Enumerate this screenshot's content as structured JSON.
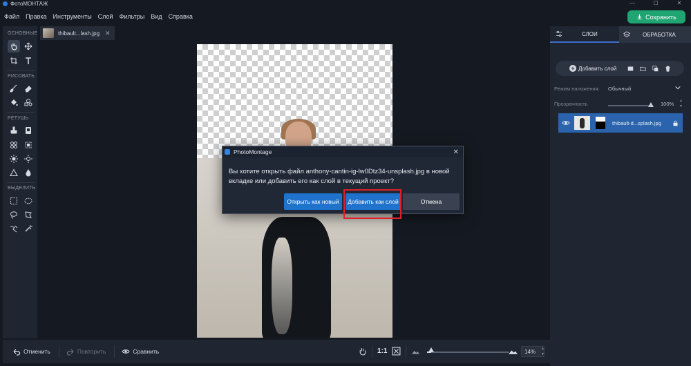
{
  "app": {
    "title": "ФотоМОНТАЖ"
  },
  "window_controls": [
    "—",
    "☐",
    "✕"
  ],
  "menu": [
    "Файл",
    "Правка",
    "Инструменты",
    "Слой",
    "Фильтры",
    "Вид",
    "Справка"
  ],
  "save_button": {
    "label": "Сохранить"
  },
  "toolbar": {
    "sections": [
      "ОСНОВНЫЕ",
      "РИСОВАТЬ",
      "РЕТУШЬ",
      "ВЫДЕЛИТЬ"
    ]
  },
  "document_tab": {
    "name": "thibault...lash.jpg"
  },
  "right_panel": {
    "tabs": [
      "СЛОИ",
      "ОБРАБОТКА"
    ],
    "add_layer_label": "Добавить слой",
    "blend_mode_label": "Режим наложения:",
    "blend_mode_value": "Обычный",
    "opacity_label": "Прозрачность",
    "opacity_value": "100%",
    "opacity_fraction": 1.0,
    "layers": [
      {
        "name": "thibault-d...splash.jpg"
      }
    ]
  },
  "bottom_bar": {
    "undo": "Отменить",
    "redo": "Повторить",
    "compare": "Сравнить",
    "actual_size": "1:1",
    "zoom_value": "14%",
    "zoom_fraction": 0.05
  },
  "dialog": {
    "title": "PhotoMontage",
    "message": "Вы хотите открыть файл anthony-cantin-ig-lw0Dtz34-unsplash.jpg в новой вкладке или добавить его как слой в текущий проект?",
    "buttons": {
      "open_new": "Открыть как новый",
      "add_layer": "Добавить как слой",
      "cancel": "Отмена"
    }
  },
  "colors": {
    "accent": "#1ea571",
    "primary_button": "#1f73cc",
    "selected_layer": "#2b64ad",
    "highlight_box": "#e0202a"
  }
}
